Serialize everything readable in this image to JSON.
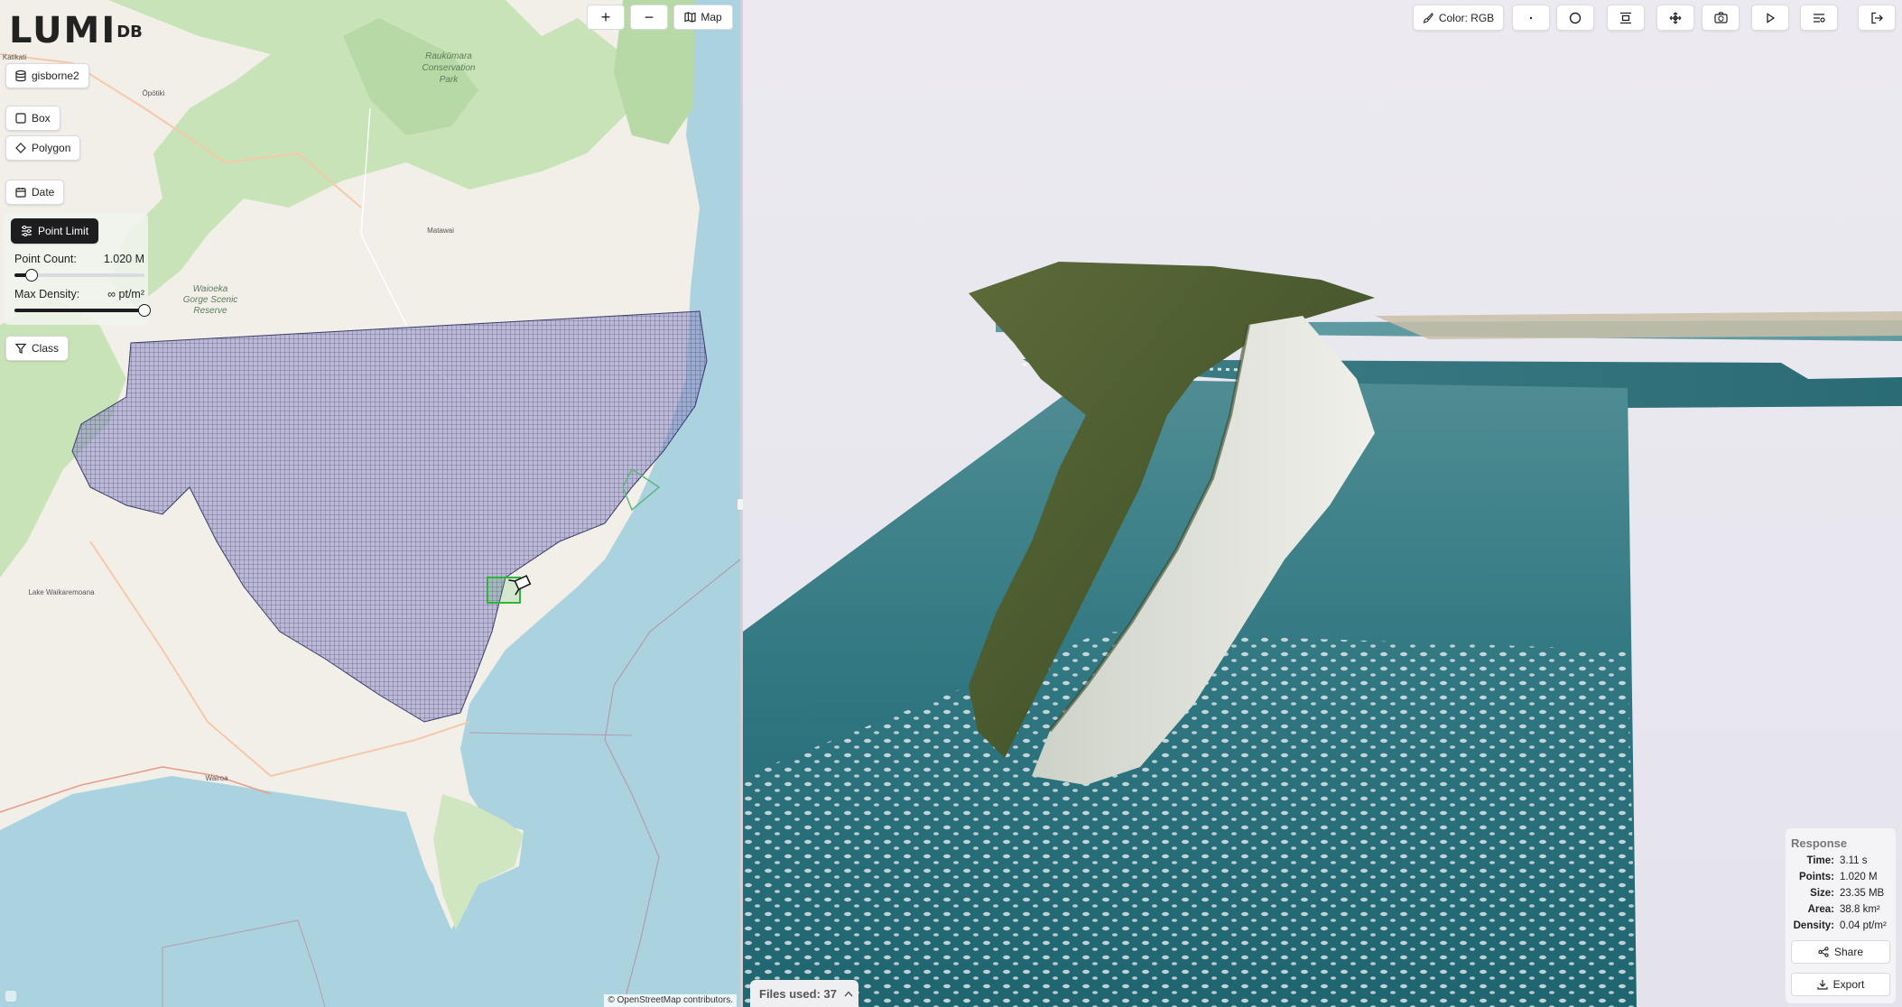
{
  "app": {
    "logo_text": "LUMI",
    "logo_suffix": "DB"
  },
  "map": {
    "dataset_label": "gisborne2",
    "box_label": "Box",
    "polygon_label": "Polygon",
    "date_label": "Date",
    "point_limit_label": "Point Limit",
    "point_count_label": "Point Count:",
    "point_count_value": "1.020 M",
    "point_count_fraction": 0.13,
    "max_density_label": "Max Density:",
    "max_density_value": "∞ pt/m²",
    "max_density_fraction": 1.0,
    "class_label": "Class",
    "zoom_in_label": "+",
    "zoom_out_label": "−",
    "map_toggle_label": "Map",
    "attribution": "© OpenStreetMap contributors.",
    "place_labels": [
      {
        "text": "Raukūmara"
      },
      {
        "text": "Conservation"
      },
      {
        "text": "Park"
      },
      {
        "text": "Waioeka"
      },
      {
        "text": "Gorge Scenic"
      },
      {
        "text": "Reserve"
      },
      {
        "text": "Ōpōtiki"
      },
      {
        "text": "Matawai"
      },
      {
        "text": "Wairoa"
      },
      {
        "text": "Lake Waikaremoana"
      },
      {
        "text": "Katikati"
      }
    ]
  },
  "toolbar": {
    "color_label": "Color: RGB",
    "icons": [
      "point-size-icon",
      "circle-icon",
      "align-center-icon",
      "move-icon",
      "camera-rotate-icon",
      "play-icon",
      "list-settings-icon",
      "logout-icon"
    ]
  },
  "view": {
    "files_used_label": "Files used: 37"
  },
  "response": {
    "title": "Response",
    "rows": [
      {
        "key": "Time:",
        "value": "3.11 s"
      },
      {
        "key": "Points:",
        "value": "1.020 M"
      },
      {
        "key": "Size:",
        "value": "23.35 MB"
      },
      {
        "key": "Area:",
        "value": "38.8 km²"
      },
      {
        "key": "Density:",
        "value": "0.04 pt/m²"
      }
    ],
    "share_label": "Share",
    "export_label": "Export"
  },
  "colors": {
    "sea": "#aad3df",
    "land": "#f2efe9",
    "forest": "#c8e3b8",
    "coverage_fill": "#8d8cc4",
    "selection": "#2fb43a"
  }
}
